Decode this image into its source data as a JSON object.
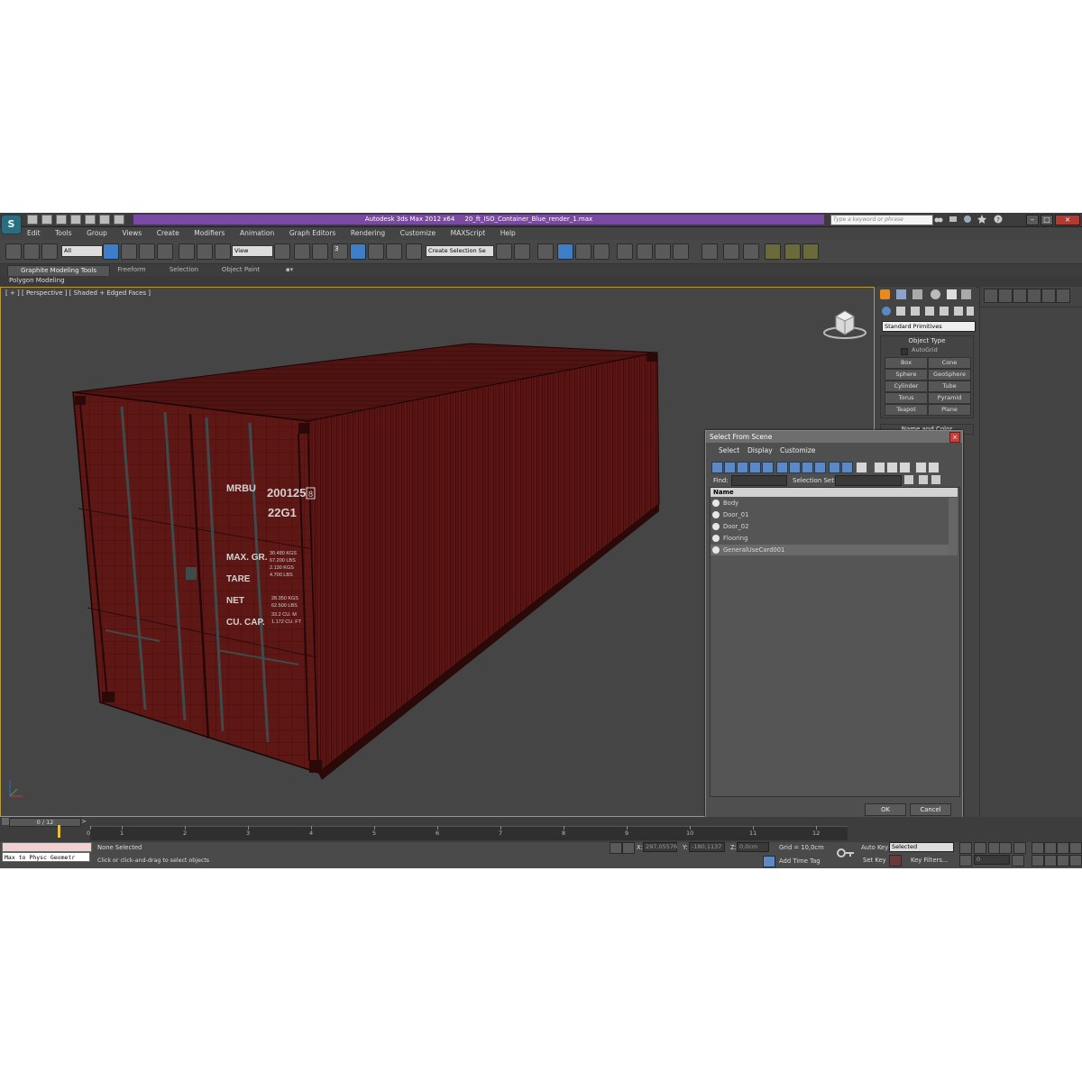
{
  "window": {
    "app_title": "Autodesk 3ds Max  2012 x64",
    "file_name": "20_ft_ISO_Container_Blue_render_1.max",
    "search_placeholder": "Type a keyword or phrase"
  },
  "menu": [
    "Edit",
    "Tools",
    "Group",
    "Views",
    "Create",
    "Modifiers",
    "Animation",
    "Graph Editors",
    "Rendering",
    "Customize",
    "MAXScript",
    "Help"
  ],
  "toolbar": {
    "selection_filter": "All",
    "reference_coord": "View",
    "named_selection": "Create Selection Se",
    "snap_label": "3"
  },
  "ribbon": {
    "tabs": [
      "Graphite Modeling Tools",
      "Freeform",
      "Selection",
      "Object Paint"
    ],
    "active_tab": "Graphite Modeling Tools",
    "panel": "Polygon Modeling"
  },
  "viewport": {
    "label": "[ + ] [ Perspective ] [ Shaded + Edged Faces ]",
    "container": {
      "owner_code": "MRBU",
      "serial": "200125",
      "check_digit": "8",
      "type_code": "22G1",
      "weight_labels": [
        "MAX. GR.",
        "TARE",
        "NET",
        "CU. CAP."
      ],
      "weights_a": [
        "30.480 KGS",
        "67.200 LBS",
        "2.130 KGS",
        "4.700 LBS"
      ],
      "weights_b": [
        "28.350 KGS",
        "62.500 LBS",
        "33.2 CU. M",
        "1.172 CU. FT"
      ]
    }
  },
  "command_panel": {
    "dropdown": "Standard Primitives",
    "rollout_title": "Object Type",
    "autogrid": "AutoGrid",
    "buttons": [
      "Box",
      "Cone",
      "Sphere",
      "GeoSphere",
      "Cylinder",
      "Tube",
      "Torus",
      "Pyramid",
      "Teapot",
      "Plane"
    ],
    "name_color": "Name and Color"
  },
  "dialog": {
    "title": "Select From Scene",
    "menus": [
      "Select",
      "Display",
      "Customize"
    ],
    "find_label": "Find:",
    "selection_set_label": "Selection Set:",
    "column_name": "Name",
    "items": [
      "Body",
      "Door_01",
      "Door_02",
      "Flooring",
      "GeneralUseCard001"
    ],
    "ok": "OK",
    "cancel": "Cancel"
  },
  "timeline": {
    "frame_display": "0 / 12",
    "ticks": [
      "0",
      "1",
      "2",
      "3",
      "4",
      "5",
      "6",
      "7",
      "8",
      "9",
      "10",
      "11",
      "12"
    ]
  },
  "status": {
    "maxscript": "Max to Physc Geometr",
    "selection": "None Selected",
    "prompt": "Click or click-and-drag to select objects",
    "x_label": "X:",
    "x_value": "297,05576",
    "y_label": "Y:",
    "y_value": "-180,1137",
    "z_label": "Z:",
    "z_value": "0,0cm",
    "grid": "Grid = 10,0cm",
    "add_time_tag": "Add Time Tag",
    "auto_key": "Auto Key",
    "set_key": "Set Key",
    "key_mode": "Selected",
    "key_filters": "Key Filters...",
    "current_frame": "0"
  },
  "colors": {
    "title_accent": "#7a4aa2",
    "container": "#5a1614",
    "viewport_border": "#b79a3a",
    "dialog_button": "#5c89c6"
  }
}
